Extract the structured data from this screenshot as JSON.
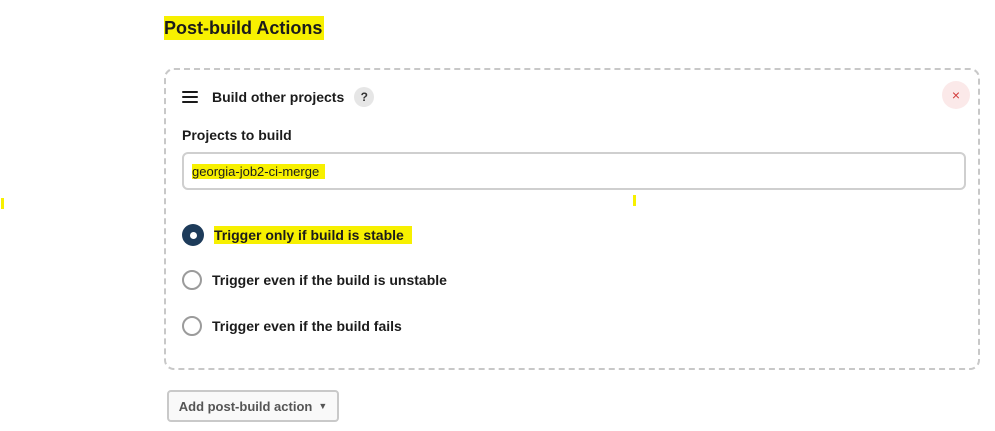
{
  "section": {
    "title": "Post-build Actions"
  },
  "card": {
    "title": "Build other projects",
    "help_symbol": "?",
    "close_symbol": "×",
    "icons": {
      "drag": "drag-handle-icon",
      "help": "help-icon",
      "close": "close-icon"
    }
  },
  "projects": {
    "label": "Projects to build",
    "value": "georgia-job2-ci-merge"
  },
  "trigger_options": [
    {
      "label": "Trigger only if build is stable",
      "checked": true
    },
    {
      "label": "Trigger even if the build is unstable",
      "checked": false
    },
    {
      "label": "Trigger even if the build fails",
      "checked": false
    }
  ],
  "add_action": {
    "label": "Add post-build action",
    "caret": "▼"
  },
  "colors": {
    "highlight": "#f7f000",
    "radio_checked": "#1d3b5a",
    "close_bg": "#fbe9e9",
    "close_fg": "#d23a3a",
    "card_border": "#c8c8c8"
  }
}
